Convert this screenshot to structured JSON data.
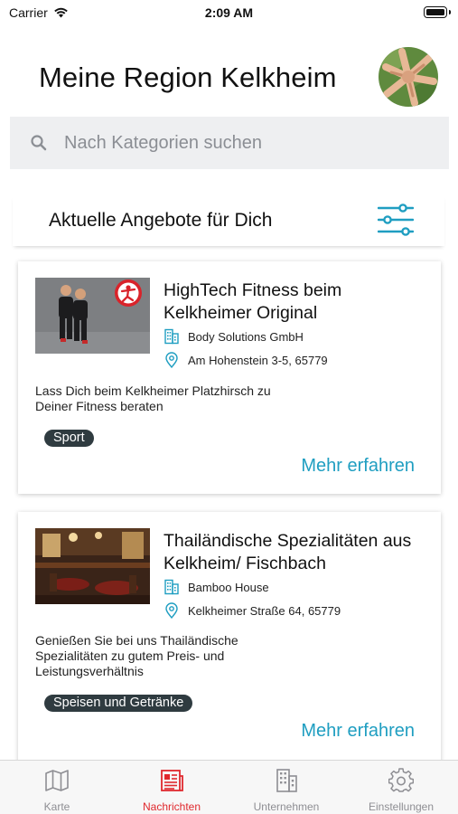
{
  "status_bar": {
    "carrier": "Carrier",
    "time": "2:09 AM"
  },
  "header": {
    "title": "Meine Region Kelkheim"
  },
  "search": {
    "placeholder": "Nach Kategorien suchen"
  },
  "section": {
    "title": "Aktuelle Angebote für Dich"
  },
  "offers": [
    {
      "title": "HighTech Fitness beim Kelkheimer Original",
      "company": "Body Solutions GmbH",
      "address": "Am Hohenstein 3-5, 65779",
      "description": "Lass Dich beim Kelkheimer Platzhirsch zu Deiner Fitness beraten",
      "tag": "Sport",
      "more_label": "Mehr erfahren"
    },
    {
      "title": "Thailändische Spezialitäten aus Kelkheim/ Fischbach",
      "company": "Bamboo House",
      "address": "Kelkheimer Straße 64, 65779",
      "description": "Genießen Sie bei uns Thailändische Spezialitäten zu gutem Preis- und Leistungsverhältnis",
      "tag": "Speisen und Getränke",
      "more_label": "Mehr erfahren"
    }
  ],
  "tabs": [
    {
      "label": "Karte",
      "icon": "map-icon",
      "active": false
    },
    {
      "label": "Nachrichten",
      "icon": "newspaper-icon",
      "active": true
    },
    {
      "label": "Unternehmen",
      "icon": "building-icon",
      "active": false
    },
    {
      "label": "Einstellungen",
      "icon": "gear-icon",
      "active": false
    }
  ],
  "colors": {
    "accent": "#1f9ec1",
    "active_tab": "#e0282d",
    "tag_bg": "#2f3b40"
  }
}
